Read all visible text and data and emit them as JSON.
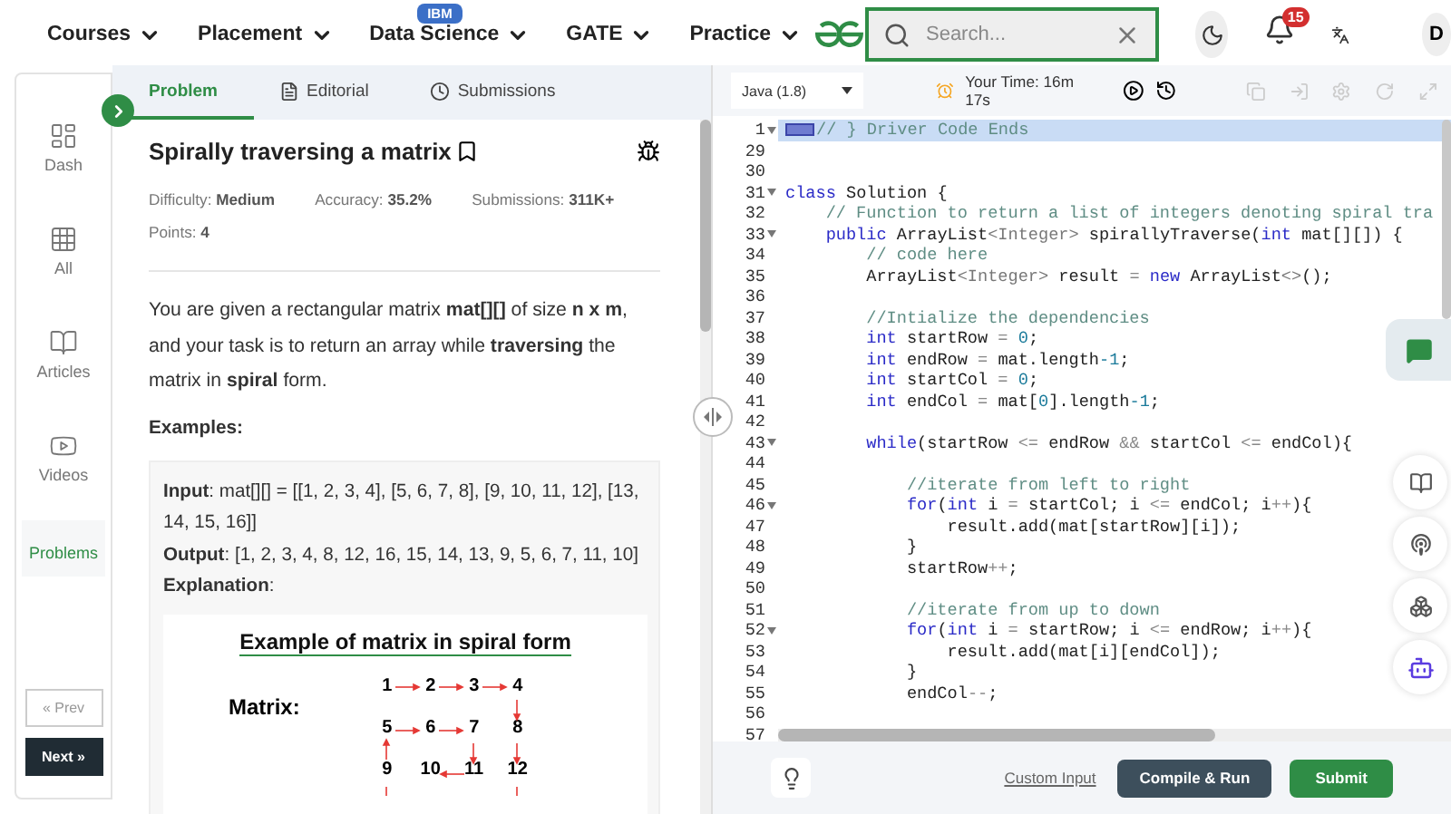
{
  "nav": {
    "items": [
      {
        "label": "Courses"
      },
      {
        "label": "Placement"
      },
      {
        "label": "Data Science",
        "badge": "IBM"
      },
      {
        "label": "GATE"
      },
      {
        "label": "Practice"
      }
    ],
    "search": {
      "placeholder": "Search..."
    },
    "notifications": "15",
    "avatar": "D"
  },
  "rail": {
    "items": [
      {
        "label": "Dash",
        "selected": false
      },
      {
        "label": "All",
        "selected": false
      },
      {
        "label": "Articles",
        "selected": false
      },
      {
        "label": "Videos",
        "selected": false
      },
      {
        "label": "Problems",
        "selected": true
      }
    ],
    "prev": "« Prev",
    "next": "Next »"
  },
  "tabs": [
    {
      "label": "Problem",
      "selected": true
    },
    {
      "label": "Editorial",
      "selected": false
    },
    {
      "label": "Submissions",
      "selected": false
    }
  ],
  "problem": {
    "title": "Spirally traversing a matrix",
    "meta": [
      "Difficulty: **Medium**",
      "Accuracy: **35.2%**",
      "Submissions: **311K+**",
      "Points: **4**"
    ],
    "description": "You are given a rectangular matrix **mat[][]** of size **n x m**, and your task is to return an array while **traversing** the matrix in **spiral** form.",
    "examples_heading": "Examples:",
    "example": [
      "**Input**: mat[][] = [[1, 2, 3, 4], [5, 6, 7, 8], [9, 10, 11, 12], [13, 14, 15, 16]]",
      "**Output**: [1, 2, 3, 4, 8, 12, 16, 15, 14, 13, 9, 5, 6, 7, 11, 10]",
      "**Explanation**:"
    ],
    "figure": {
      "title": "Example of matrix in spiral form",
      "label": "Matrix:",
      "rows": [
        [
          "1",
          "2",
          "3",
          "4"
        ],
        [
          "5",
          "6",
          "7",
          "8"
        ],
        [
          "9",
          "10",
          "11",
          "12"
        ]
      ]
    }
  },
  "editor": {
    "language": "Java (1.8)",
    "timer": "Your Time: 16m 17s",
    "lines": [
      {
        "n": "1",
        "fold": true,
        "highlighted": true,
        "folded": true,
        "tokens": [
          {
            "kind": "comment",
            "text": "// } Driver Code Ends"
          }
        ]
      },
      {
        "n": "29",
        "fold": false,
        "highlighted": false,
        "folded": false
      },
      {
        "n": "30",
        "fold": false,
        "highlighted": false,
        "folded": false
      },
      {
        "n": "31",
        "fold": true,
        "highlighted": false,
        "folded": false,
        "tokens": [
          {
            "kind": "keyword",
            "text": "class"
          },
          {
            "kind": "plain",
            "text": " Solution {"
          }
        ]
      },
      {
        "n": "32",
        "fold": false,
        "highlighted": false,
        "folded": false,
        "tokens": [
          {
            "kind": "comment",
            "text": "    // Function to return a list of integers denoting spiral tra"
          }
        ]
      },
      {
        "n": "33",
        "fold": true,
        "highlighted": false,
        "folded": false,
        "tokens": [
          {
            "kind": "keyword",
            "text": "    public"
          },
          {
            "kind": "plain",
            "text": " ArrayList"
          },
          {
            "kind": "type",
            "text": "<Integer>"
          },
          {
            "kind": "plain",
            "text": " spirallyTraverse("
          },
          {
            "kind": "keyword",
            "text": "int"
          },
          {
            "kind": "plain",
            "text": " mat[][]) {"
          }
        ]
      },
      {
        "n": "34",
        "fold": false,
        "highlighted": false,
        "folded": false,
        "tokens": [
          {
            "kind": "comment",
            "text": "        // code here"
          }
        ]
      },
      {
        "n": "35",
        "fold": false,
        "highlighted": false,
        "folded": false,
        "tokens": [
          {
            "kind": "plain",
            "text": "        ArrayList"
          },
          {
            "kind": "type",
            "text": "<Integer>"
          },
          {
            "kind": "plain",
            "text": " result "
          },
          {
            "kind": "operator",
            "text": "= "
          },
          {
            "kind": "keyword",
            "text": "new"
          },
          {
            "kind": "plain",
            "text": " ArrayList"
          },
          {
            "kind": "type",
            "text": "<>"
          },
          {
            "kind": "plain",
            "text": "();"
          }
        ]
      },
      {
        "n": "36",
        "fold": false,
        "highlighted": false,
        "folded": false
      },
      {
        "n": "37",
        "fold": false,
        "highlighted": false,
        "folded": false,
        "tokens": [
          {
            "kind": "comment",
            "text": "        //Intialize the dependencies"
          }
        ]
      },
      {
        "n": "38",
        "fold": false,
        "highlighted": false,
        "folded": false,
        "tokens": [
          {
            "kind": "keyword",
            "text": "        int"
          },
          {
            "kind": "plain",
            "text": " startRow "
          },
          {
            "kind": "operator",
            "text": "= "
          },
          {
            "kind": "number",
            "text": "0"
          },
          {
            "kind": "plain",
            "text": ";"
          }
        ]
      },
      {
        "n": "39",
        "fold": false,
        "highlighted": false,
        "folded": false,
        "tokens": [
          {
            "kind": "keyword",
            "text": "        int"
          },
          {
            "kind": "plain",
            "text": " endRow "
          },
          {
            "kind": "operator",
            "text": "="
          },
          {
            "kind": "plain",
            "text": " mat.length"
          },
          {
            "kind": "number",
            "text": "-1"
          },
          {
            "kind": "plain",
            "text": ";"
          }
        ]
      },
      {
        "n": "40",
        "fold": false,
        "highlighted": false,
        "folded": false,
        "tokens": [
          {
            "kind": "keyword",
            "text": "        int"
          },
          {
            "kind": "plain",
            "text": " startCol "
          },
          {
            "kind": "operator",
            "text": "= "
          },
          {
            "kind": "number",
            "text": "0"
          },
          {
            "kind": "plain",
            "text": ";"
          }
        ]
      },
      {
        "n": "41",
        "fold": false,
        "highlighted": false,
        "folded": false,
        "tokens": [
          {
            "kind": "keyword",
            "text": "        int"
          },
          {
            "kind": "plain",
            "text": " endCol "
          },
          {
            "kind": "operator",
            "text": "="
          },
          {
            "kind": "plain",
            "text": " mat["
          },
          {
            "kind": "number",
            "text": "0"
          },
          {
            "kind": "plain",
            "text": "].length"
          },
          {
            "kind": "number",
            "text": "-1"
          },
          {
            "kind": "plain",
            "text": ";"
          }
        ]
      },
      {
        "n": "42",
        "fold": false,
        "highlighted": false,
        "folded": false
      },
      {
        "n": "43",
        "fold": true,
        "highlighted": false,
        "folded": false,
        "tokens": [
          {
            "kind": "keyword",
            "text": "        while"
          },
          {
            "kind": "plain",
            "text": "(startRow "
          },
          {
            "kind": "operator",
            "text": "<="
          },
          {
            "kind": "plain",
            "text": " endRow "
          },
          {
            "kind": "operator",
            "text": "&&"
          },
          {
            "kind": "plain",
            "text": " startCol "
          },
          {
            "kind": "operator",
            "text": "<="
          },
          {
            "kind": "plain",
            "text": " endCol){"
          }
        ]
      },
      {
        "n": "44",
        "fold": false,
        "highlighted": false,
        "folded": false
      },
      {
        "n": "45",
        "fold": false,
        "highlighted": false,
        "folded": false,
        "tokens": [
          {
            "kind": "comment",
            "text": "            //iterate from left to right"
          }
        ]
      },
      {
        "n": "46",
        "fold": true,
        "highlighted": false,
        "folded": false,
        "tokens": [
          {
            "kind": "keyword",
            "text": "            for"
          },
          {
            "kind": "plain",
            "text": "("
          },
          {
            "kind": "keyword",
            "text": "int"
          },
          {
            "kind": "plain",
            "text": " i "
          },
          {
            "kind": "operator",
            "text": "="
          },
          {
            "kind": "plain",
            "text": " startCol; i "
          },
          {
            "kind": "operator",
            "text": "<="
          },
          {
            "kind": "plain",
            "text": " endCol; i"
          },
          {
            "kind": "operator",
            "text": "++"
          },
          {
            "kind": "plain",
            "text": "){"
          }
        ]
      },
      {
        "n": "47",
        "fold": false,
        "highlighted": false,
        "folded": false,
        "tokens": [
          {
            "kind": "plain",
            "text": "                result.add(mat[startRow][i]);"
          }
        ]
      },
      {
        "n": "48",
        "fold": false,
        "highlighted": false,
        "folded": false,
        "tokens": [
          {
            "kind": "plain",
            "text": "            }"
          }
        ]
      },
      {
        "n": "49",
        "fold": false,
        "highlighted": false,
        "folded": false,
        "tokens": [
          {
            "kind": "plain",
            "text": "            startRow"
          },
          {
            "kind": "operator",
            "text": "++"
          },
          {
            "kind": "plain",
            "text": ";"
          }
        ]
      },
      {
        "n": "50",
        "fold": false,
        "highlighted": false,
        "folded": false
      },
      {
        "n": "51",
        "fold": false,
        "highlighted": false,
        "folded": false,
        "tokens": [
          {
            "kind": "comment",
            "text": "            //iterate from up to down"
          }
        ]
      },
      {
        "n": "52",
        "fold": true,
        "highlighted": false,
        "folded": false,
        "tokens": [
          {
            "kind": "keyword",
            "text": "            for"
          },
          {
            "kind": "plain",
            "text": "("
          },
          {
            "kind": "keyword",
            "text": "int"
          },
          {
            "kind": "plain",
            "text": " i "
          },
          {
            "kind": "operator",
            "text": "="
          },
          {
            "kind": "plain",
            "text": " startRow; i "
          },
          {
            "kind": "operator",
            "text": "<="
          },
          {
            "kind": "plain",
            "text": " endRow; i"
          },
          {
            "kind": "operator",
            "text": "++"
          },
          {
            "kind": "plain",
            "text": "){"
          }
        ]
      },
      {
        "n": "53",
        "fold": false,
        "highlighted": false,
        "folded": false,
        "tokens": [
          {
            "kind": "plain",
            "text": "                result.add(mat[i][endCol]);"
          }
        ]
      },
      {
        "n": "54",
        "fold": false,
        "highlighted": false,
        "folded": false,
        "tokens": [
          {
            "kind": "plain",
            "text": "            }"
          }
        ]
      },
      {
        "n": "55",
        "fold": false,
        "highlighted": false,
        "folded": false,
        "tokens": [
          {
            "kind": "plain",
            "text": "            endCol"
          },
          {
            "kind": "operator",
            "text": "--"
          },
          {
            "kind": "plain",
            "text": ";"
          }
        ]
      },
      {
        "n": "56",
        "fold": false,
        "highlighted": false,
        "folded": false
      },
      {
        "n": "57",
        "fold": false,
        "highlighted": false,
        "folded": false
      }
    ]
  },
  "bottom": {
    "custom_input": "Custom Input",
    "compile": "Compile & Run",
    "submit": "Submit"
  }
}
